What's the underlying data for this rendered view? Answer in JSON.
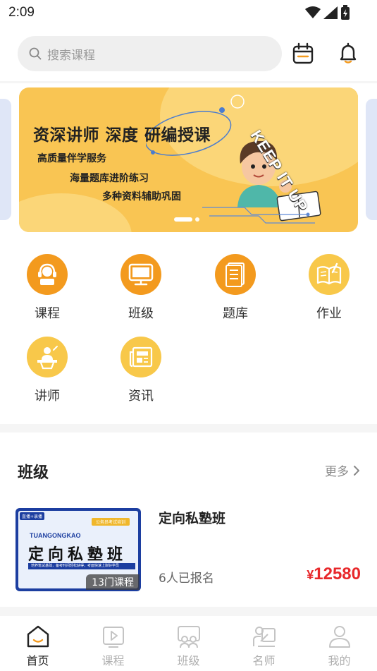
{
  "status_bar": {
    "time": "2:09"
  },
  "search": {
    "placeholder": "搜索课程"
  },
  "banner": {
    "headline": "资深讲师  深度  研编授课",
    "line1": "高质量伴学服务",
    "line2": "海量题库进阶练习",
    "line3": "多种资料辅助巩固",
    "badge": "KEEP IT UP"
  },
  "grid": [
    {
      "label": "课程",
      "icon": "headset-icon",
      "color": "#f39a1e"
    },
    {
      "label": "班级",
      "icon": "monitor-icon",
      "color": "#f39a1e"
    },
    {
      "label": "题库",
      "icon": "document-icon",
      "color": "#f39a1e"
    },
    {
      "label": "作业",
      "icon": "book-icon",
      "color": "#f8c84a"
    },
    {
      "label": "讲师",
      "icon": "lecturer-icon",
      "color": "#f8c84a"
    },
    {
      "label": "资讯",
      "icon": "newspaper-icon",
      "color": "#f8c84a"
    }
  ],
  "class_section": {
    "title": "班级",
    "more": "更多"
  },
  "course": {
    "name": "定向私塾班",
    "enrolled": "6人已报名",
    "currency": "¥",
    "price": "12580",
    "thumb_tag": "直播+录播",
    "thumb_tag2": "公务员考试培训",
    "thumb_brand": "TUANGONGKAO",
    "thumb_title": "定向私塾班",
    "thumb_sub": "培养笔试基础，备考时间轻松获得，考面快速上岸好学员",
    "course_count": "13门课程"
  },
  "bottom_nav": [
    {
      "label": "首页",
      "icon": "home-icon",
      "active": true
    },
    {
      "label": "课程",
      "icon": "play-icon",
      "active": false
    },
    {
      "label": "班级",
      "icon": "class-icon",
      "active": false
    },
    {
      "label": "名师",
      "icon": "teacher-icon",
      "active": false
    },
    {
      "label": "我的",
      "icon": "profile-icon",
      "active": false
    }
  ],
  "colors": {
    "accent": "#f39a1e",
    "price": "#e8282b",
    "banner": "#f9c553"
  }
}
